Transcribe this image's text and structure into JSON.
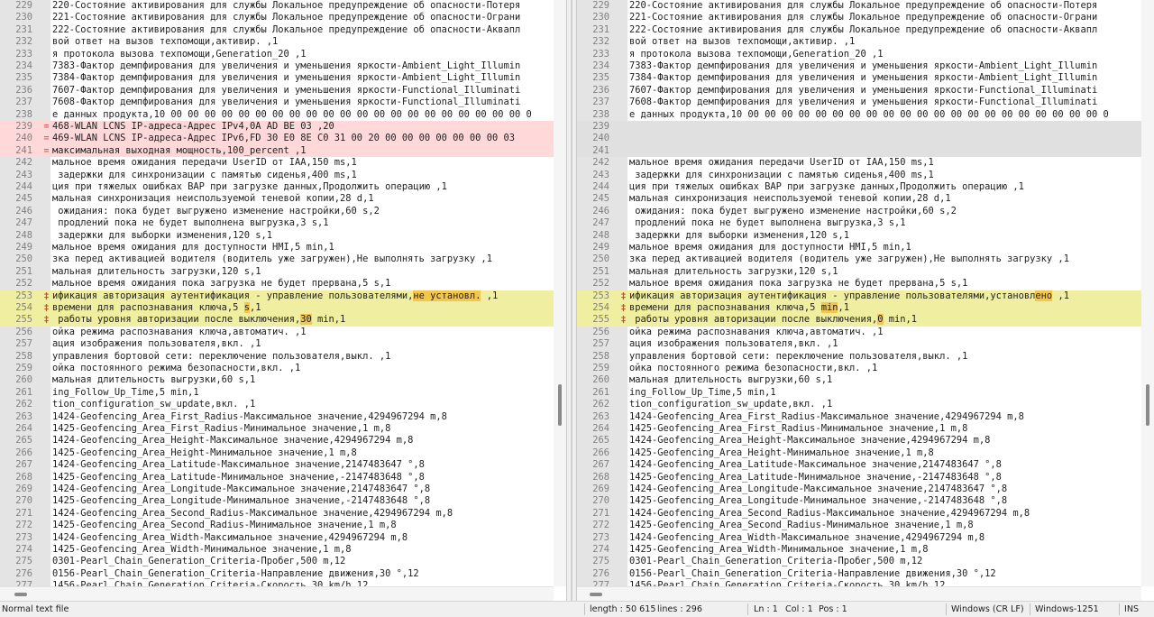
{
  "left_pane": {
    "lines": [
      {
        "num": "229",
        "text": "220-Состояние активирования для службы Локальное предупреждение об опасности-Потеря",
        "type": "normal"
      },
      {
        "num": "230",
        "text": "221-Состояние активирования для службы Локальное предупреждение об опасности-Ограни",
        "type": "normal"
      },
      {
        "num": "231",
        "text": "222-Состояние активирования для службы Локальное предупреждение об опасности-Аквапл",
        "type": "normal"
      },
      {
        "num": "232",
        "text": "вой ответ на вызов техпомощи,активир. ,1",
        "type": "normal"
      },
      {
        "num": "233",
        "text": "я протокола вызова техпомощи,Generation_20 ,1",
        "type": "normal"
      },
      {
        "num": "234",
        "text": "7383-Фактор демпфирования для увеличения и уменьшения яркости-Ambient_Light_Illumin",
        "type": "normal"
      },
      {
        "num": "235",
        "text": "7384-Фактор демпфирования для увеличения и уменьшения яркости-Ambient_Light_Illumin",
        "type": "normal"
      },
      {
        "num": "236",
        "text": "7607-Фактор демпфирования для увеличения и уменьшения яркости-Functional_Illuminati",
        "type": "normal"
      },
      {
        "num": "237",
        "text": "7608-Фактор демпфирования для увеличения и уменьшения яркости-Functional_Illuminati",
        "type": "normal"
      },
      {
        "num": "238",
        "text": "е данных продукта,10 00 00 00 00 00 00 00 00 00 00 00 00 00 00 00 00 00 00 00 00 00 0",
        "type": "normal"
      },
      {
        "num": "239",
        "text": "468-WLAN LCNS IP-адреса-Адрес IPv4,0A AD BE 03 ,20",
        "type": "removed",
        "mark": "="
      },
      {
        "num": "240",
        "text": "469-WLAN LCNS IP-адреса-Адрес IPv6,FD 30 E0 8E C0 31 00 20 00 00 00 00 00 00 00 03",
        "type": "removed",
        "mark": "="
      },
      {
        "num": "241",
        "text": "максимальная выходная мощность,100_percent ,1",
        "type": "removed",
        "mark": "="
      },
      {
        "num": "242",
        "text": "мальное время ожидания передачи UserID от IAA,150 ms,1",
        "type": "normal"
      },
      {
        "num": "243",
        "text": " задержки для синхронизации с памятью сиденья,400 ms,1",
        "type": "normal"
      },
      {
        "num": "244",
        "text": "ция при тяжелых ошибках BAP при загрузке данных,Продолжить операцию ,1",
        "type": "normal"
      },
      {
        "num": "245",
        "text": "мальная синхронизация неиспользуемой теневой копии,28 d,1",
        "type": "normal"
      },
      {
        "num": "246",
        "text": " ожидания: пока будет выгружено изменение настройки,60 s,2",
        "type": "normal"
      },
      {
        "num": "247",
        "text": " продлений пока не будет выполнена выгрузка,3 s,1",
        "type": "normal"
      },
      {
        "num": "248",
        "text": " задержки для выборки изменения,120 s,1",
        "type": "normal"
      },
      {
        "num": "249",
        "text": "мальное время ожидания для доступности HMI,5 min,1",
        "type": "normal"
      },
      {
        "num": "250",
        "text": "зка перед активацией водителя (водитель уже загружен),Не выполнять загрузку ,1",
        "type": "normal"
      },
      {
        "num": "251",
        "text": "мальная длительность загрузки,120 s,1",
        "type": "normal"
      },
      {
        "num": "252",
        "text": "мальное время ожидания пока загрузка не будет прервана,5 s,1",
        "type": "normal"
      },
      {
        "num": "253",
        "text": "ификация авторизация аутентификация - управление пользователями,",
        "hl": "не установл.",
        "after": " ,1",
        "type": "changed",
        "mark": "‡"
      },
      {
        "num": "254",
        "text": "времени для распознавания ключа,5 ",
        "hl": "s",
        "after": ",1",
        "type": "changed",
        "mark": "‡"
      },
      {
        "num": "255",
        "text": " работы уровня авторизации после выключения,",
        "hl": "30",
        "after": " min,1",
        "type": "changed",
        "mark": "‡"
      },
      {
        "num": "256",
        "text": "ойка режима распознавания ключа,автоматич. ,1",
        "type": "normal"
      },
      {
        "num": "257",
        "text": "ация изображения пользователя,вкл. ,1",
        "type": "normal"
      },
      {
        "num": "258",
        "text": "управления бортовой сети: переключение пользователя,выкл. ,1",
        "type": "normal"
      },
      {
        "num": "259",
        "text": "ойка постоянного режима безопасности,вкл. ,1",
        "type": "normal"
      },
      {
        "num": "260",
        "text": "мальная длительность выгрузки,60 s,1",
        "type": "normal"
      },
      {
        "num": "261",
        "text": "ing_Follow_Up_Time,5 min,1",
        "type": "normal"
      },
      {
        "num": "262",
        "text": "tion_configuration_sw_update,вкл. ,1",
        "type": "normal"
      },
      {
        "num": "263",
        "text": "1424-Geofencing_Area_First_Radius-Максимальное значение,4294967294 m,8",
        "type": "normal"
      },
      {
        "num": "264",
        "text": "1425-Geofencing_Area_First_Radius-Минимальное значение,1 m,8",
        "type": "normal"
      },
      {
        "num": "265",
        "text": "1424-Geofencing_Area_Height-Максимальное значение,4294967294 m,8",
        "type": "normal"
      },
      {
        "num": "266",
        "text": "1425-Geofencing_Area_Height-Минимальное значение,1 m,8",
        "type": "normal"
      },
      {
        "num": "267",
        "text": "1424-Geofencing_Area_Latitude-Максимальное значение,2147483647 °,8",
        "type": "normal"
      },
      {
        "num": "268",
        "text": "1425-Geofencing_Area_Latitude-Минимальное значение,-2147483648 °,8",
        "type": "normal"
      },
      {
        "num": "269",
        "text": "1424-Geofencing_Area_Longitude-Максимальное значение,2147483647 °,8",
        "type": "normal"
      },
      {
        "num": "270",
        "text": "1425-Geofencing_Area_Longitude-Минимальное значение,-2147483648 °,8",
        "type": "normal"
      },
      {
        "num": "271",
        "text": "1424-Geofencing_Area_Second_Radius-Максимальное значение,4294967294 m,8",
        "type": "normal"
      },
      {
        "num": "272",
        "text": "1425-Geofencing_Area_Second_Radius-Минимальное значение,1 m,8",
        "type": "normal"
      },
      {
        "num": "273",
        "text": "1424-Geofencing_Area_Width-Максимальное значение,4294967294 m,8",
        "type": "normal"
      },
      {
        "num": "274",
        "text": "1425-Geofencing_Area_Width-Минимальное значение,1 m,8",
        "type": "normal"
      },
      {
        "num": "275",
        "text": "0301-Pearl_Chain_Generation_Criteria-Пробег,500 m,12",
        "type": "normal"
      },
      {
        "num": "276",
        "text": "0156-Pearl_Chain_Generation_Criteria-Направление движения,30 °,12",
        "type": "normal"
      },
      {
        "num": "277",
        "text": "1456-Pearl_Chain_Generation_Criteria-Скорость,30 km/h,12",
        "type": "normal"
      }
    ]
  },
  "right_pane": {
    "lines": [
      {
        "num": "229",
        "text": "220-Состояние активирования для службы Локальное предупреждение об опасности-Потеря",
        "type": "normal"
      },
      {
        "num": "230",
        "text": "221-Состояние активирования для службы Локальное предупреждение об опасности-Ограни",
        "type": "normal"
      },
      {
        "num": "231",
        "text": "222-Состояние активирования для службы Локальное предупреждение об опасности-Аквапл",
        "type": "normal"
      },
      {
        "num": "232",
        "text": "вой ответ на вызов техпомощи,активир. ,1",
        "type": "normal"
      },
      {
        "num": "233",
        "text": "я протокола вызова техпомощи,Generation_20 ,1",
        "type": "normal"
      },
      {
        "num": "234",
        "text": "7383-Фактор демпфирования для увеличения и уменьшения яркости-Ambient_Light_Illumin",
        "type": "normal"
      },
      {
        "num": "235",
        "text": "7384-Фактор демпфирования для увеличения и уменьшения яркости-Ambient_Light_Illumin",
        "type": "normal"
      },
      {
        "num": "236",
        "text": "7607-Фактор демпфирования для увеличения и уменьшения яркости-Functional_Illuminati",
        "type": "normal"
      },
      {
        "num": "237",
        "text": "7608-Фактор демпфирования для увеличения и уменьшения яркости-Functional_Illuminati",
        "type": "normal"
      },
      {
        "num": "238",
        "text": "е данных продукта,10 00 00 00 00 00 00 00 00 00 00 00 00 00 00 00 00 00 00 00 00 00 0",
        "type": "normal"
      },
      {
        "num": "239",
        "text": "",
        "type": "blank"
      },
      {
        "num": "240",
        "text": "",
        "type": "blank"
      },
      {
        "num": "241",
        "text": "",
        "type": "blank"
      },
      {
        "num": "242",
        "text": "мальное время ожидания передачи UserID от IAA,150 ms,1",
        "type": "normal"
      },
      {
        "num": "243",
        "text": " задержки для синхронизации с памятью сиденья,400 ms,1",
        "type": "normal"
      },
      {
        "num": "244",
        "text": "ция при тяжелых ошибках BAP при загрузке данных,Продолжить операцию ,1",
        "type": "normal"
      },
      {
        "num": "245",
        "text": "мальная синхронизация неиспользуемой теневой копии,28 d,1",
        "type": "normal"
      },
      {
        "num": "246",
        "text": " ожидания: пока будет выгружено изменение настройки,60 s,2",
        "type": "normal"
      },
      {
        "num": "247",
        "text": " продлений пока не будет выполнена выгрузка,3 s,1",
        "type": "normal"
      },
      {
        "num": "248",
        "text": " задержки для выборки изменения,120 s,1",
        "type": "normal"
      },
      {
        "num": "249",
        "text": "мальное время ожидания для доступности HMI,5 min,1",
        "type": "normal"
      },
      {
        "num": "250",
        "text": "зка перед активацией водителя (водитель уже загружен),Не выполнять загрузку ,1",
        "type": "normal"
      },
      {
        "num": "251",
        "text": "мальная длительность загрузки,120 s,1",
        "type": "normal"
      },
      {
        "num": "252",
        "text": "мальное время ожидания пока загрузка не будет прервана,5 s,1",
        "type": "normal"
      },
      {
        "num": "253",
        "text": "ификация авторизация аутентификация - управление пользователями,установл",
        "hl": "ено",
        "after": " ,1",
        "type": "changed",
        "mark": "‡"
      },
      {
        "num": "254",
        "text": "времени для распознавания ключа,5 ",
        "hl": "min",
        "after": ",1",
        "type": "changed",
        "mark": "‡"
      },
      {
        "num": "255",
        "text": " работы уровня авторизации после выключения,",
        "hl": "0",
        "after": " min,1",
        "type": "changed",
        "mark": "‡"
      },
      {
        "num": "256",
        "text": "ойка режима распознавания ключа,автоматич. ,1",
        "type": "normal"
      },
      {
        "num": "257",
        "text": "ация изображения пользователя,вкл. ,1",
        "type": "normal"
      },
      {
        "num": "258",
        "text": "управления бортовой сети: переключение пользователя,выкл. ,1",
        "type": "normal"
      },
      {
        "num": "259",
        "text": "ойка постоянного режима безопасности,вкл. ,1",
        "type": "normal"
      },
      {
        "num": "260",
        "text": "мальная длительность выгрузки,60 s,1",
        "type": "normal"
      },
      {
        "num": "261",
        "text": "ing_Follow_Up_Time,5 min,1",
        "type": "normal"
      },
      {
        "num": "262",
        "text": "tion_configuration_sw_update,вкл. ,1",
        "type": "normal"
      },
      {
        "num": "263",
        "text": "1424-Geofencing_Area_First_Radius-Максимальное значение,4294967294 m,8",
        "type": "normal"
      },
      {
        "num": "264",
        "text": "1425-Geofencing_Area_First_Radius-Минимальное значение,1 m,8",
        "type": "normal"
      },
      {
        "num": "265",
        "text": "1424-Geofencing_Area_Height-Максимальное значение,4294967294 m,8",
        "type": "normal"
      },
      {
        "num": "266",
        "text": "1425-Geofencing_Area_Height-Минимальное значение,1 m,8",
        "type": "normal"
      },
      {
        "num": "267",
        "text": "1424-Geofencing_Area_Latitude-Максимальное значение,2147483647 °,8",
        "type": "normal"
      },
      {
        "num": "268",
        "text": "1425-Geofencing_Area_Latitude-Минимальное значение,-2147483648 °,8",
        "type": "normal"
      },
      {
        "num": "269",
        "text": "1424-Geofencing_Area_Longitude-Максимальное значение,2147483647 °,8",
        "type": "normal"
      },
      {
        "num": "270",
        "text": "1425-Geofencing_Area_Longitude-Минимальное значение,-2147483648 °,8",
        "type": "normal"
      },
      {
        "num": "271",
        "text": "1424-Geofencing_Area_Second_Radius-Максимальное значение,4294967294 m,8",
        "type": "normal"
      },
      {
        "num": "272",
        "text": "1425-Geofencing_Area_Second_Radius-Минимальное значение,1 m,8",
        "type": "normal"
      },
      {
        "num": "273",
        "text": "1424-Geofencing_Area_Width-Максимальное значение,4294967294 m,8",
        "type": "normal"
      },
      {
        "num": "274",
        "text": "1425-Geofencing_Area_Width-Минимальное значение,1 m,8",
        "type": "normal"
      },
      {
        "num": "275",
        "text": "0301-Pearl_Chain_Generation_Criteria-Пробег,500 m,12",
        "type": "normal"
      },
      {
        "num": "276",
        "text": "0156-Pearl_Chain_Generation_Criteria-Направление движения,30 °,12",
        "type": "normal"
      },
      {
        "num": "277",
        "text": "1456-Pearl_Chain_Generation_Criteria-Скорость,30 km/h,12",
        "type": "normal"
      }
    ]
  },
  "status_bar": {
    "file_type": "Normal text file",
    "length": "length : 50 615",
    "lines": "lines : 296",
    "line_pos": "Ln : 1",
    "col_pos": "Col : 1",
    "pos": "Pos : 1",
    "eol": "Windows (CR LF)",
    "encoding": "Windows-1251",
    "mode": "INS"
  },
  "colors": {
    "removed_bg": "#ffd9d9",
    "changed_bg": "#f0eea0",
    "word_highlight": "#f2c64f",
    "blank_bg": "#e0e0e0"
  },
  "icons": {
    "removed_marker": "minus-marker-icon",
    "changed_marker": "changed-marker-icon"
  }
}
